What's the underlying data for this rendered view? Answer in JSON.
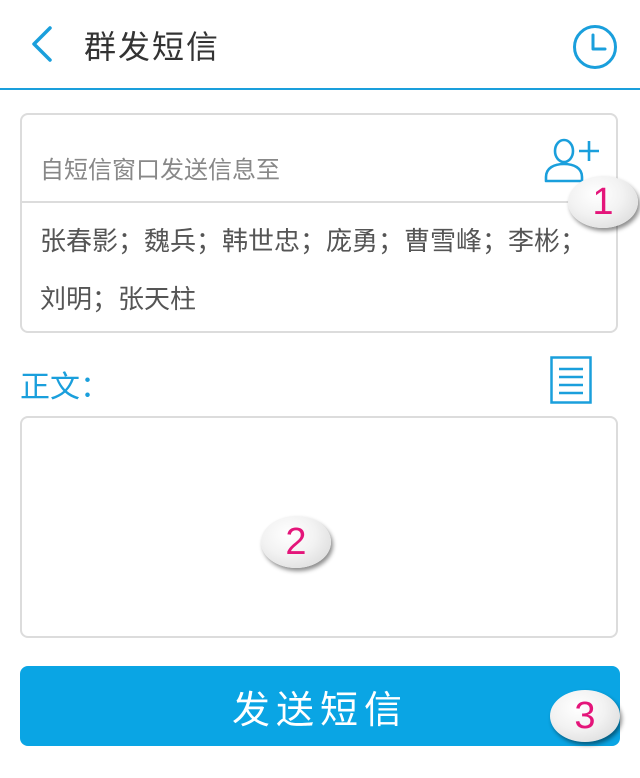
{
  "header": {
    "title": "群发短信"
  },
  "recipients": {
    "label": "自短信窗口发送信息至",
    "list": "张春影；魏兵；韩世忠；庞勇；曹雪峰；李彬；刘明；张天柱"
  },
  "message": {
    "label": "正文：",
    "value": ""
  },
  "send_button": {
    "label": "发送短信"
  },
  "callouts": [
    "1",
    "2",
    "3"
  ],
  "colors": {
    "accent": "#1a9fdc",
    "button": "#0aa5e4",
    "callout_text": "#e4157a"
  },
  "icons": [
    "back-icon",
    "clock-icon",
    "add-contact-icon",
    "template-icon"
  ]
}
